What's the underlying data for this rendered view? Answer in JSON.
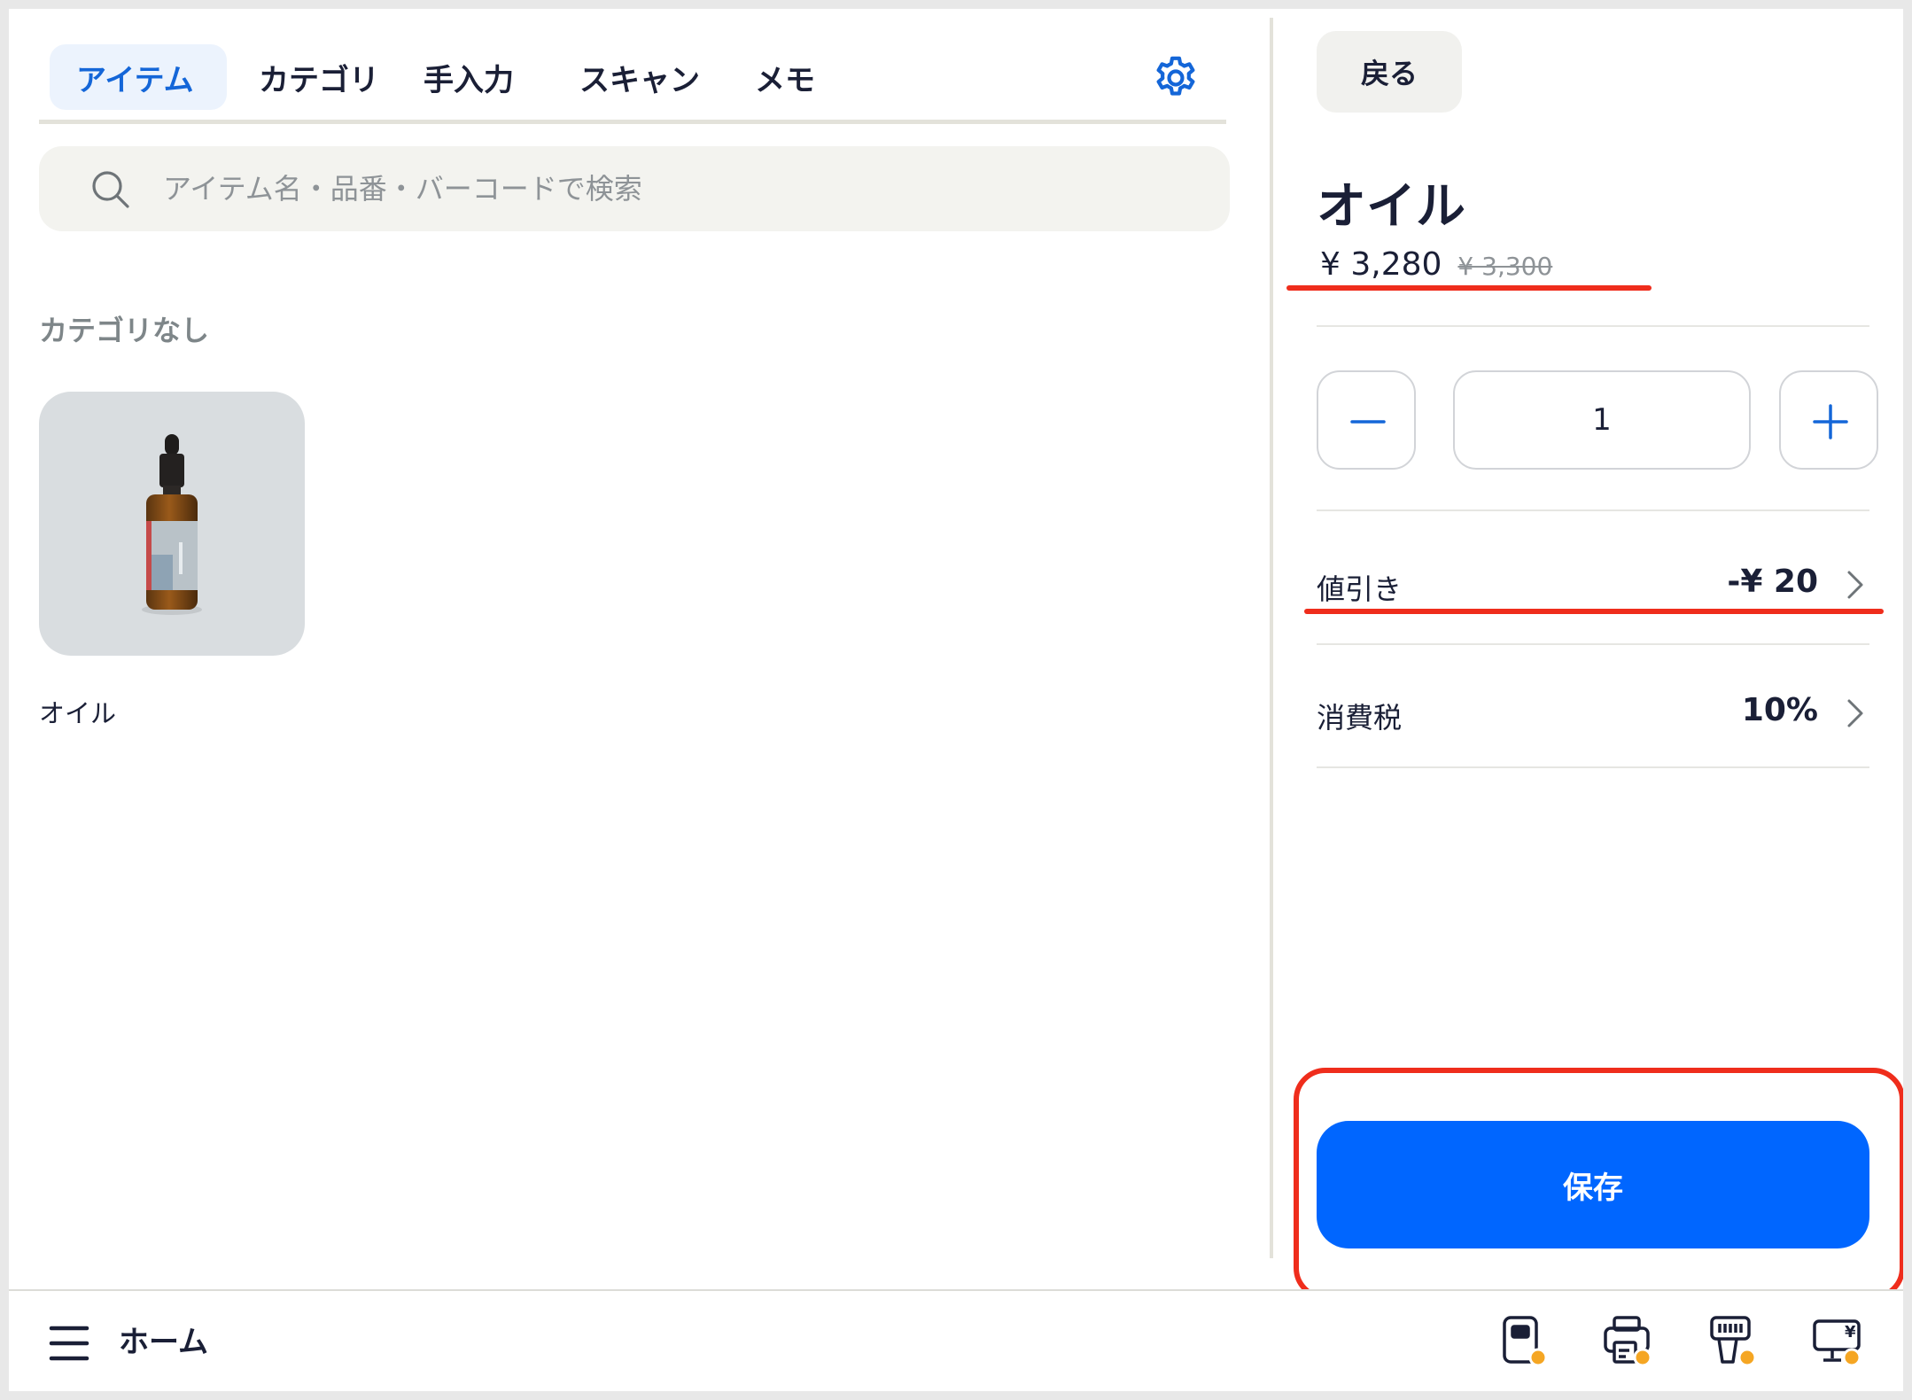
{
  "tabs": [
    {
      "label": "アイテム",
      "active": true
    },
    {
      "label": "カテゴリ",
      "active": false
    },
    {
      "label": "手入力",
      "active": false
    },
    {
      "label": "スキャン",
      "active": false
    },
    {
      "label": "メモ",
      "active": false
    }
  ],
  "search": {
    "placeholder": "アイテム名・品番・バーコードで検索",
    "value": ""
  },
  "catalog": {
    "section_title": "カテゴリなし",
    "items": [
      {
        "name": "オイル"
      }
    ]
  },
  "detail": {
    "back_label": "戻る",
    "title": "オイル",
    "price": "¥ 3,280",
    "original_price": "¥ 3,300",
    "quantity": "1",
    "discount": {
      "label": "値引き",
      "value": "-¥ 20"
    },
    "tax": {
      "label": "消費税",
      "value": "10%"
    },
    "save_label": "保存"
  },
  "bottom": {
    "home_label": "ホーム"
  },
  "colors": {
    "accent": "#0066ff",
    "accent_text": "#1466d8",
    "annotation": "#ef2d1c",
    "status_dot": "#f5a623"
  },
  "icons": {
    "settings": "gear-icon",
    "search": "search-icon",
    "menu": "menu-icon",
    "devices": [
      "card-reader-icon",
      "receipt-printer-icon",
      "barcode-scanner-icon",
      "customer-display-icon"
    ]
  }
}
